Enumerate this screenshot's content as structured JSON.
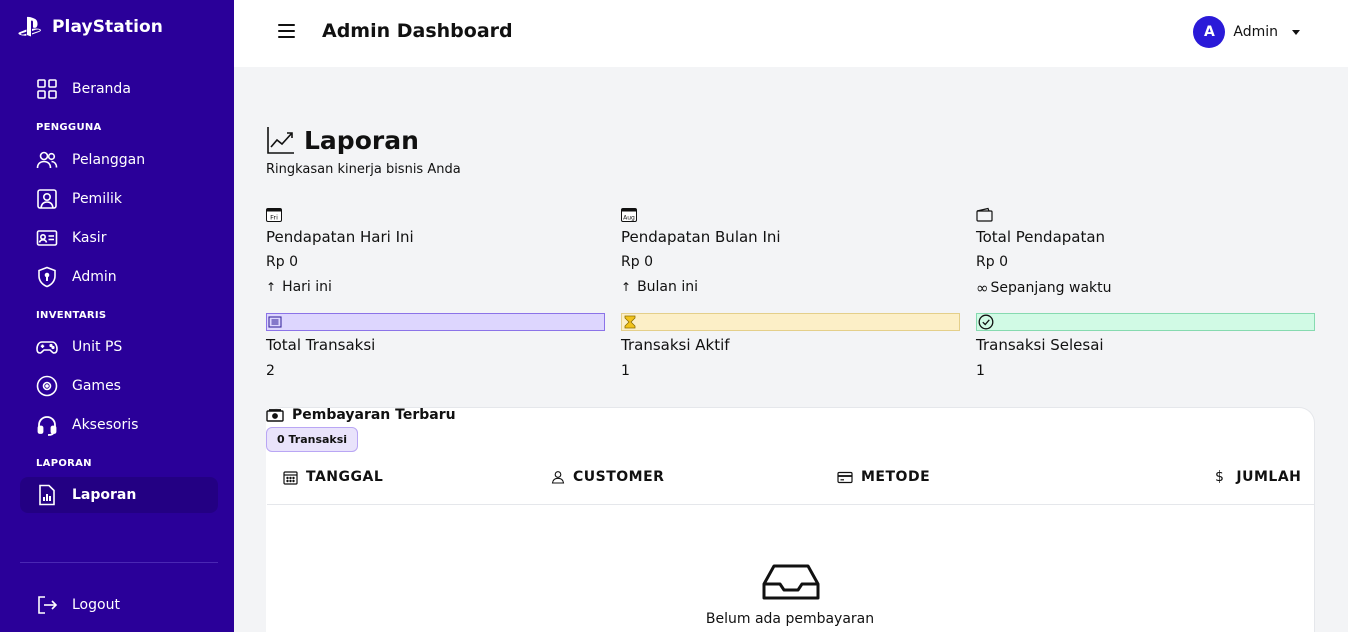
{
  "brand": {
    "name": "PlayStation"
  },
  "sidebar": {
    "items": [
      {
        "label": "Beranda"
      },
      {
        "label": "Pelanggan"
      },
      {
        "label": "Pemilik"
      },
      {
        "label": "Kasir"
      },
      {
        "label": "Admin"
      },
      {
        "label": "Unit PS"
      },
      {
        "label": "Games"
      },
      {
        "label": "Aksesoris"
      },
      {
        "label": "Laporan"
      }
    ],
    "sections": [
      "PENGGUNA",
      "INVENTARIS",
      "LAPORAN"
    ],
    "logout": "Logout"
  },
  "header": {
    "title": "Admin Dashboard",
    "user": {
      "initial": "A",
      "name": "Admin"
    }
  },
  "report": {
    "title": "Laporan",
    "subtitle": "Ringkasan kinerja bisnis Anda",
    "cards": [
      {
        "icon": "calendar-day-icon",
        "icon_text": "Fri",
        "label": "Pendapatan Hari Ini",
        "value": "Rp 0",
        "note": "Hari ini"
      },
      {
        "icon": "calendar-month-icon",
        "icon_text": "Aug",
        "label": "Pendapatan Bulan Ini",
        "value": "Rp 0",
        "note": "Bulan ini"
      },
      {
        "icon": "wallet-icon",
        "label": "Total Pendapatan",
        "value": "Rp 0",
        "note": "Sepanjang waktu"
      }
    ],
    "txcards": [
      {
        "icon": "receipt-icon",
        "color": "#ddd6fe",
        "border": "#8b73e8",
        "label": "Total Transaksi",
        "value": "2"
      },
      {
        "icon": "hourglass-icon",
        "color": "#fcefc7",
        "border": "#e4cf8a",
        "label": "Transaksi Aktif",
        "value": "1"
      },
      {
        "icon": "check-circle-icon",
        "color": "#d1fae5",
        "border": "#86dab0",
        "label": "Transaksi Selesai",
        "value": "1"
      }
    ]
  },
  "payments": {
    "title": "Pembayaran Terbaru",
    "badge": "0 Transaksi",
    "columns": [
      "TANGGAL",
      "CUSTOMER",
      "METODE",
      "JUMLAH"
    ],
    "empty_text": "Belum ada pembayaran"
  },
  "colors": {
    "sidebar": "#2a0099",
    "avatar": "#2a1ad8"
  }
}
